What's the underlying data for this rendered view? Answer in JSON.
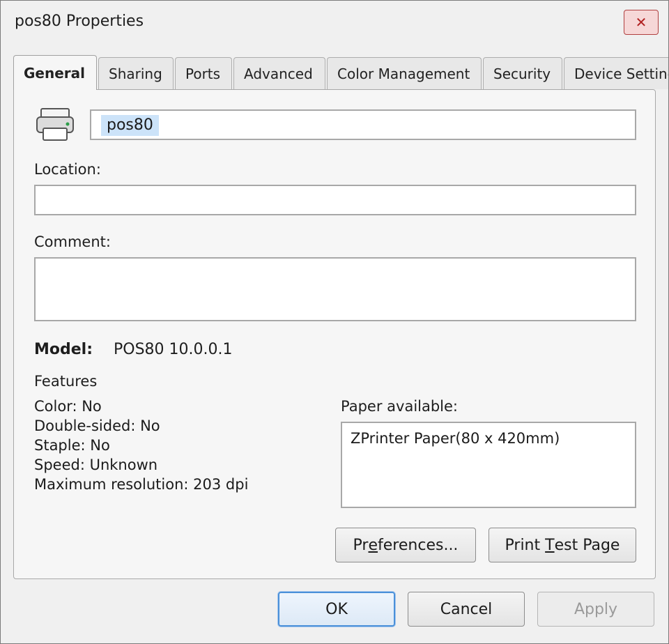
{
  "window": {
    "title": "pos80 Properties",
    "close_label": "✕"
  },
  "tabs": [
    {
      "label": "General",
      "active": true
    },
    {
      "label": "Sharing",
      "active": false
    },
    {
      "label": "Ports",
      "active": false
    },
    {
      "label": "Advanced",
      "active": false
    },
    {
      "label": "Color Management",
      "active": false
    },
    {
      "label": "Security",
      "active": false
    },
    {
      "label": "Device Settings",
      "active": false
    }
  ],
  "general": {
    "printer_name": "pos80",
    "location_label": "Location:",
    "location_value": "",
    "comment_label": "Comment:",
    "comment_value": "",
    "model_label": "Model:",
    "model_value": "POS80 10.0.0.1",
    "features_title": "Features",
    "features": [
      "Color: No",
      "Double-sided: No",
      "Staple: No",
      "Speed: Unknown",
      "Maximum resolution: 203 dpi"
    ],
    "paper_label": "Paper available:",
    "paper_items": [
      "ZPrinter Paper(80 x 420mm)"
    ],
    "preferences_pre": "Pr",
    "preferences_key": "e",
    "preferences_post": "ferences...",
    "test_pre": "Print ",
    "test_key": "T",
    "test_post": "est Page"
  },
  "footer": {
    "ok_label": "OK",
    "cancel_label": "Cancel",
    "apply_label": "Apply"
  },
  "icons": {
    "printer": "printer-icon",
    "close": "close-icon"
  }
}
